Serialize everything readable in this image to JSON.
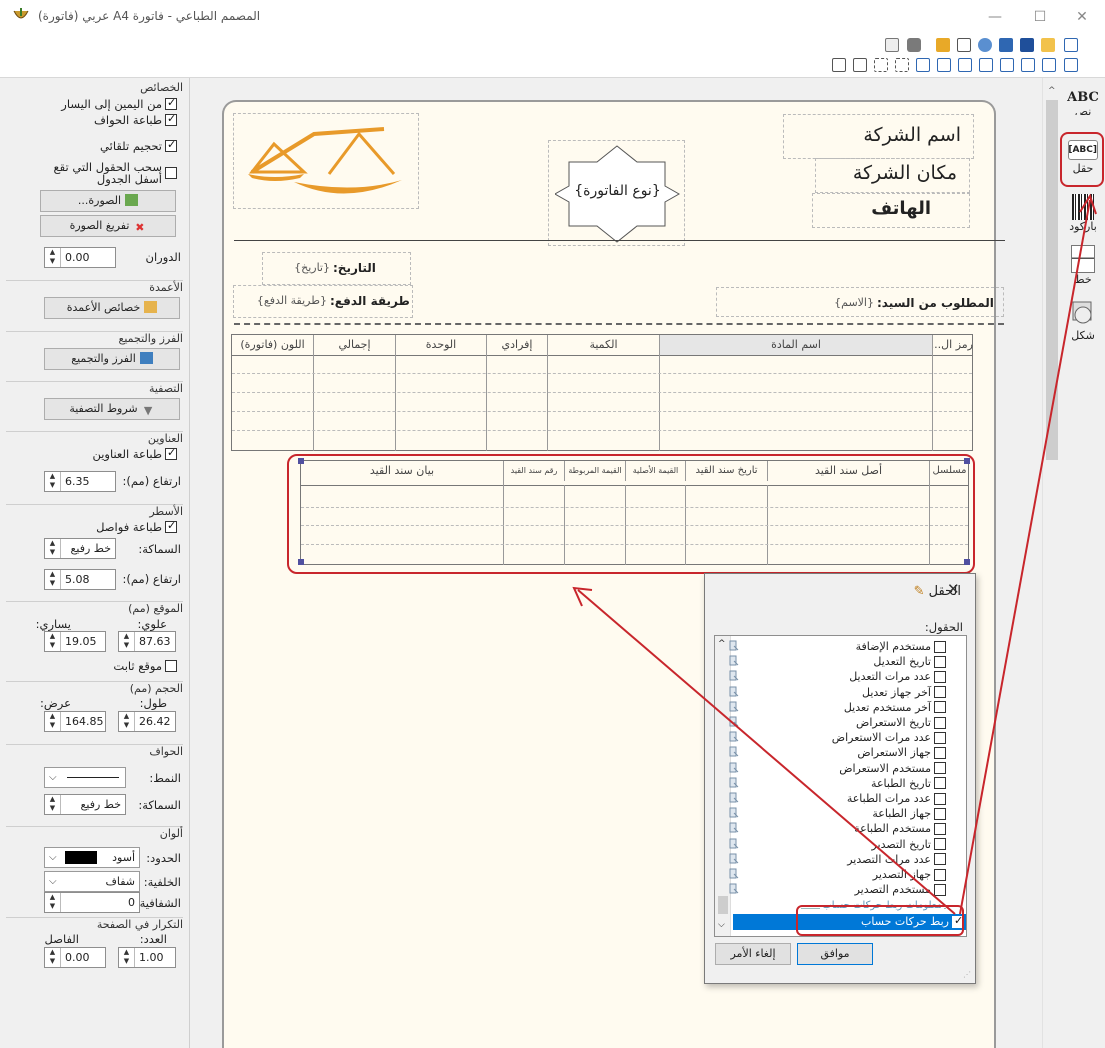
{
  "window": {
    "title": "المصمم الطباعي - فاتورة A4 عربي (فاتورة)",
    "minimize": "—",
    "maximize": "☐",
    "close": "✕"
  },
  "left_panel": {
    "properties": {
      "title": "الخصائص",
      "rtl": "من اليمين إلى اليسار",
      "print_borders": "طباعة الحواف",
      "auto_size": "تحجيم تلقائي",
      "pull_fields": "سحب الحقول التي تقع أسفل الجدول",
      "image_btn": "الصورة...",
      "clear_image_btn": "تفريغ الصورة",
      "rotation_label": "الدوران",
      "rotation_value": "0.00"
    },
    "columns": {
      "title": "الأعمدة",
      "btn": "خصائص الأعمدة"
    },
    "sort_group": {
      "title": "الفرز والتجميع",
      "btn": "الفرز والتجميع"
    },
    "filter": {
      "title": "التصفية",
      "btn": "شروط التصفية"
    },
    "headers": {
      "title": "العناوين",
      "print_headers": "طباعة العناوين",
      "height_label": "ارتفاع (مم):",
      "height_value": "6.35"
    },
    "rows": {
      "title": "الأسطر",
      "print_separators": "طباعة فواصل",
      "thickness_label": "السماكة:",
      "thickness_value": "خط رفيع",
      "height_label": "ارتفاع (مم):",
      "height_value": "5.08"
    },
    "position": {
      "title": "الموقع (مم)",
      "top_label": "علوي:",
      "left_label": "يساري:",
      "top_value": "87.63",
      "left_value": "19.05",
      "fixed": "موقع ثابت"
    },
    "size": {
      "title": "الحجم (مم)",
      "length_label": "طول:",
      "width_label": "عرض:",
      "length_value": "26.42",
      "width_value": "164.85"
    },
    "borders": {
      "title": "الحواف",
      "style_label": "النمط:",
      "thickness_label": "السماكة:",
      "thickness_value": "خط رفيع"
    },
    "colors": {
      "title": "ألوان",
      "border_label": "الحدود:",
      "border_value": "أسود",
      "bg_label": "الخلفية:",
      "bg_value": "شفاف",
      "transparency_label": "الشفافية",
      "transparency_value": "0"
    },
    "repeat": {
      "title": "التكرار في الصفحة",
      "count_label": "العدد:",
      "spacing_label": "الفاصل",
      "count_value": "1.00",
      "spacing_value": "0.00"
    }
  },
  "right_panel": {
    "tools": [
      {
        "icon": "ABC",
        "label": "نص"
      },
      {
        "icon": "[ABC]",
        "label": "حقل"
      },
      {
        "icon": "",
        "label": "باركود"
      },
      {
        "icon": "",
        "label": "خط"
      },
      {
        "icon": "",
        "label": "شكل"
      }
    ]
  },
  "invoice": {
    "company_name": "اسم الشركة",
    "company_place": "مكان الشركة",
    "phone": "الهاتف",
    "invoice_type": "{نوع الفاتورة}",
    "date_label": "التاريخ:",
    "date_value": "{تاريخ}",
    "payment_label": "طريقة الدفع:",
    "payment_value": "{طريقة الدفع}",
    "customer_label": "المطلوب من السيد:",
    "customer_value": "{الاسم}",
    "items_columns": [
      "رمز ال...",
      "اسم المادة",
      "الكمية",
      "إفرادي",
      "الوحدة",
      "إجمالي",
      "اللون (فاتورة)"
    ],
    "journal_columns": [
      "مسلسل",
      "أصل سند القيد",
      "تاريخ سند القيد",
      "القيمة الأصلية",
      "القيمة المربوطة",
      "رقم سند القيد",
      "بيان سند القيد"
    ]
  },
  "dialog": {
    "title": "الحقل",
    "close": "✕",
    "fields_label": "الحقول:",
    "fields": [
      {
        "label": "مستخدم الإضافة",
        "checked": false
      },
      {
        "label": "تاريخ التعديل",
        "checked": false
      },
      {
        "label": "عدد مرات التعديل",
        "checked": false
      },
      {
        "label": "آخر جهاز تعديل",
        "checked": false
      },
      {
        "label": "آخر مستخدم تعديل",
        "checked": false
      },
      {
        "label": "تاريخ الاستعراض",
        "checked": false
      },
      {
        "label": "عدد مرات الاستعراض",
        "checked": false
      },
      {
        "label": "جهاز الاستعراض",
        "checked": false
      },
      {
        "label": "مستخدم الاستعراض",
        "checked": false
      },
      {
        "label": "تاريخ الطباعة",
        "checked": false
      },
      {
        "label": "عدد مرات الطباعة",
        "checked": false
      },
      {
        "label": "جهاز الطباعة",
        "checked": false
      },
      {
        "label": "مستخدم الطباعة",
        "checked": false
      },
      {
        "label": "تاريخ التصدير",
        "checked": false
      },
      {
        "label": "عدد مرات التصدير",
        "checked": false
      },
      {
        "label": "جهاز التصدير",
        "checked": false
      },
      {
        "label": "مستخدم التصدير",
        "checked": false
      }
    ],
    "section_header": "معلومات ربط حركات حساب",
    "selected_field": "ربط حركات حساب",
    "ok": "موافق",
    "cancel": "إلغاء الأمر"
  },
  "colors": {
    "accent": "#c8262c",
    "selection": "#0078d7",
    "page_bg": "#fffbf0"
  }
}
